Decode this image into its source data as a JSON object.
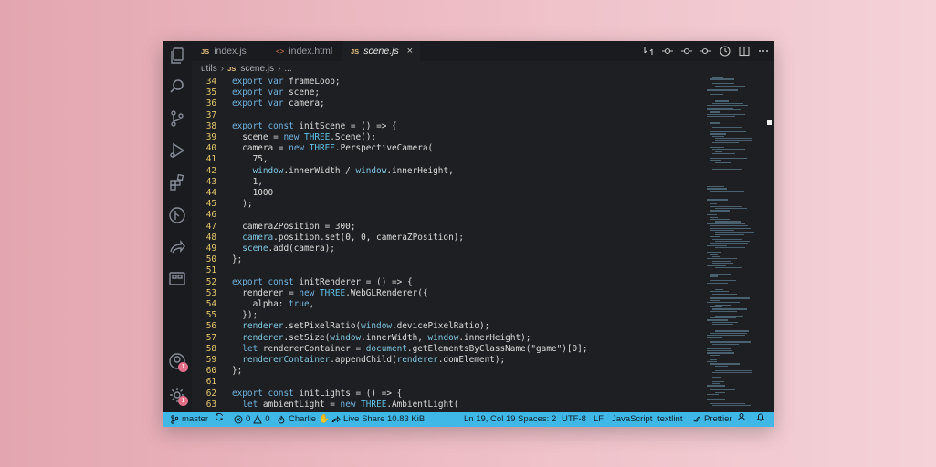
{
  "tabs": [
    {
      "badge": "JS",
      "label": "index.js",
      "active": false
    },
    {
      "badge": "<>",
      "label": "index.html",
      "active": false
    },
    {
      "badge": "JS",
      "label": "scene.js",
      "active": true
    }
  ],
  "tab_close": "×",
  "breadcrumb": {
    "folder": "utils",
    "badge": "JS",
    "file": "scene.js",
    "more": "..."
  },
  "activity_badges": {
    "accounts": "1",
    "settings": "1"
  },
  "status": {
    "branch": "master",
    "errors": "0",
    "warnings": "0",
    "user": "Charlie",
    "live_share": "Live Share",
    "file_size": "10.83 KiB",
    "cursor": "Ln 19, Col 19",
    "spaces": "Spaces: 2",
    "encoding": "UTF-8",
    "eol": "LF",
    "language": "JavaScript",
    "linter": "textlint",
    "formatter": "Prettier"
  },
  "code_lines": [
    {
      "n": "34",
      "text": "export var frameLoop;"
    },
    {
      "n": "35",
      "text": "export var scene;"
    },
    {
      "n": "36",
      "text": "export var camera;"
    },
    {
      "n": "37",
      "text": ""
    },
    {
      "n": "38",
      "text": "export const initScene = () => {"
    },
    {
      "n": "39",
      "text": "  scene = new THREE.Scene();"
    },
    {
      "n": "40",
      "text": "  camera = new THREE.PerspectiveCamera("
    },
    {
      "n": "41",
      "text": "    75,"
    },
    {
      "n": "42",
      "text": "    window.innerWidth / window.innerHeight,"
    },
    {
      "n": "43",
      "text": "    1,"
    },
    {
      "n": "44",
      "text": "    1000"
    },
    {
      "n": "45",
      "text": "  );"
    },
    {
      "n": "46",
      "text": ""
    },
    {
      "n": "47",
      "text": "  cameraZPosition = 300;"
    },
    {
      "n": "48",
      "text": "  camera.position.set(0, 0, cameraZPosition);"
    },
    {
      "n": "49",
      "text": "  scene.add(camera);"
    },
    {
      "n": "50",
      "text": "};"
    },
    {
      "n": "51",
      "text": ""
    },
    {
      "n": "52",
      "text": "export const initRenderer = () => {"
    },
    {
      "n": "53",
      "text": "  renderer = new THREE.WebGLRenderer({"
    },
    {
      "n": "54",
      "text": "    alpha: true,"
    },
    {
      "n": "55",
      "text": "  });"
    },
    {
      "n": "56",
      "text": "  renderer.setPixelRatio(window.devicePixelRatio);"
    },
    {
      "n": "57",
      "text": "  renderer.setSize(window.innerWidth, window.innerHeight);"
    },
    {
      "n": "58",
      "text": "  let rendererContainer = document.getElementsByClassName(\"game\")[0];"
    },
    {
      "n": "59",
      "text": "  rendererContainer.appendChild(renderer.domElement);"
    },
    {
      "n": "60",
      "text": "};"
    },
    {
      "n": "61",
      "text": ""
    },
    {
      "n": "62",
      "text": "export const initLights = () => {"
    },
    {
      "n": "63",
      "text": "  let ambientLight = new THREE.AmbientLight("
    }
  ],
  "colors": {
    "window_bg": "#1e1f22",
    "line_number": "#e4c76b",
    "keyword": "#6fb3e0",
    "status_bar": "#3fb8e8",
    "background_left": "#e3a6b0",
    "background_right": "#f4d2d8"
  }
}
